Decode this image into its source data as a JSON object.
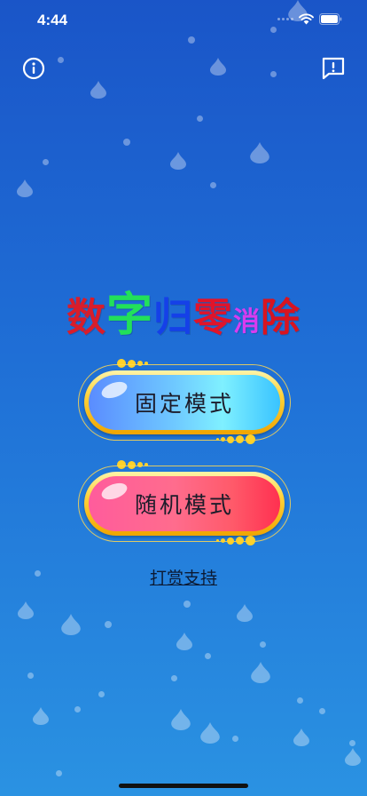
{
  "status_bar": {
    "time": "4:44"
  },
  "title": {
    "chars": [
      "数",
      "字",
      "归",
      "零",
      "消",
      "除"
    ],
    "colors": [
      "#d81d2b",
      "#22e05a",
      "#1540e8",
      "#e0142a",
      "#d83cf0",
      "#d81420"
    ]
  },
  "buttons": {
    "fixed_mode": {
      "label": "固定模式"
    },
    "random_mode": {
      "label": "随机模式"
    }
  },
  "support_link": "打赏支持"
}
